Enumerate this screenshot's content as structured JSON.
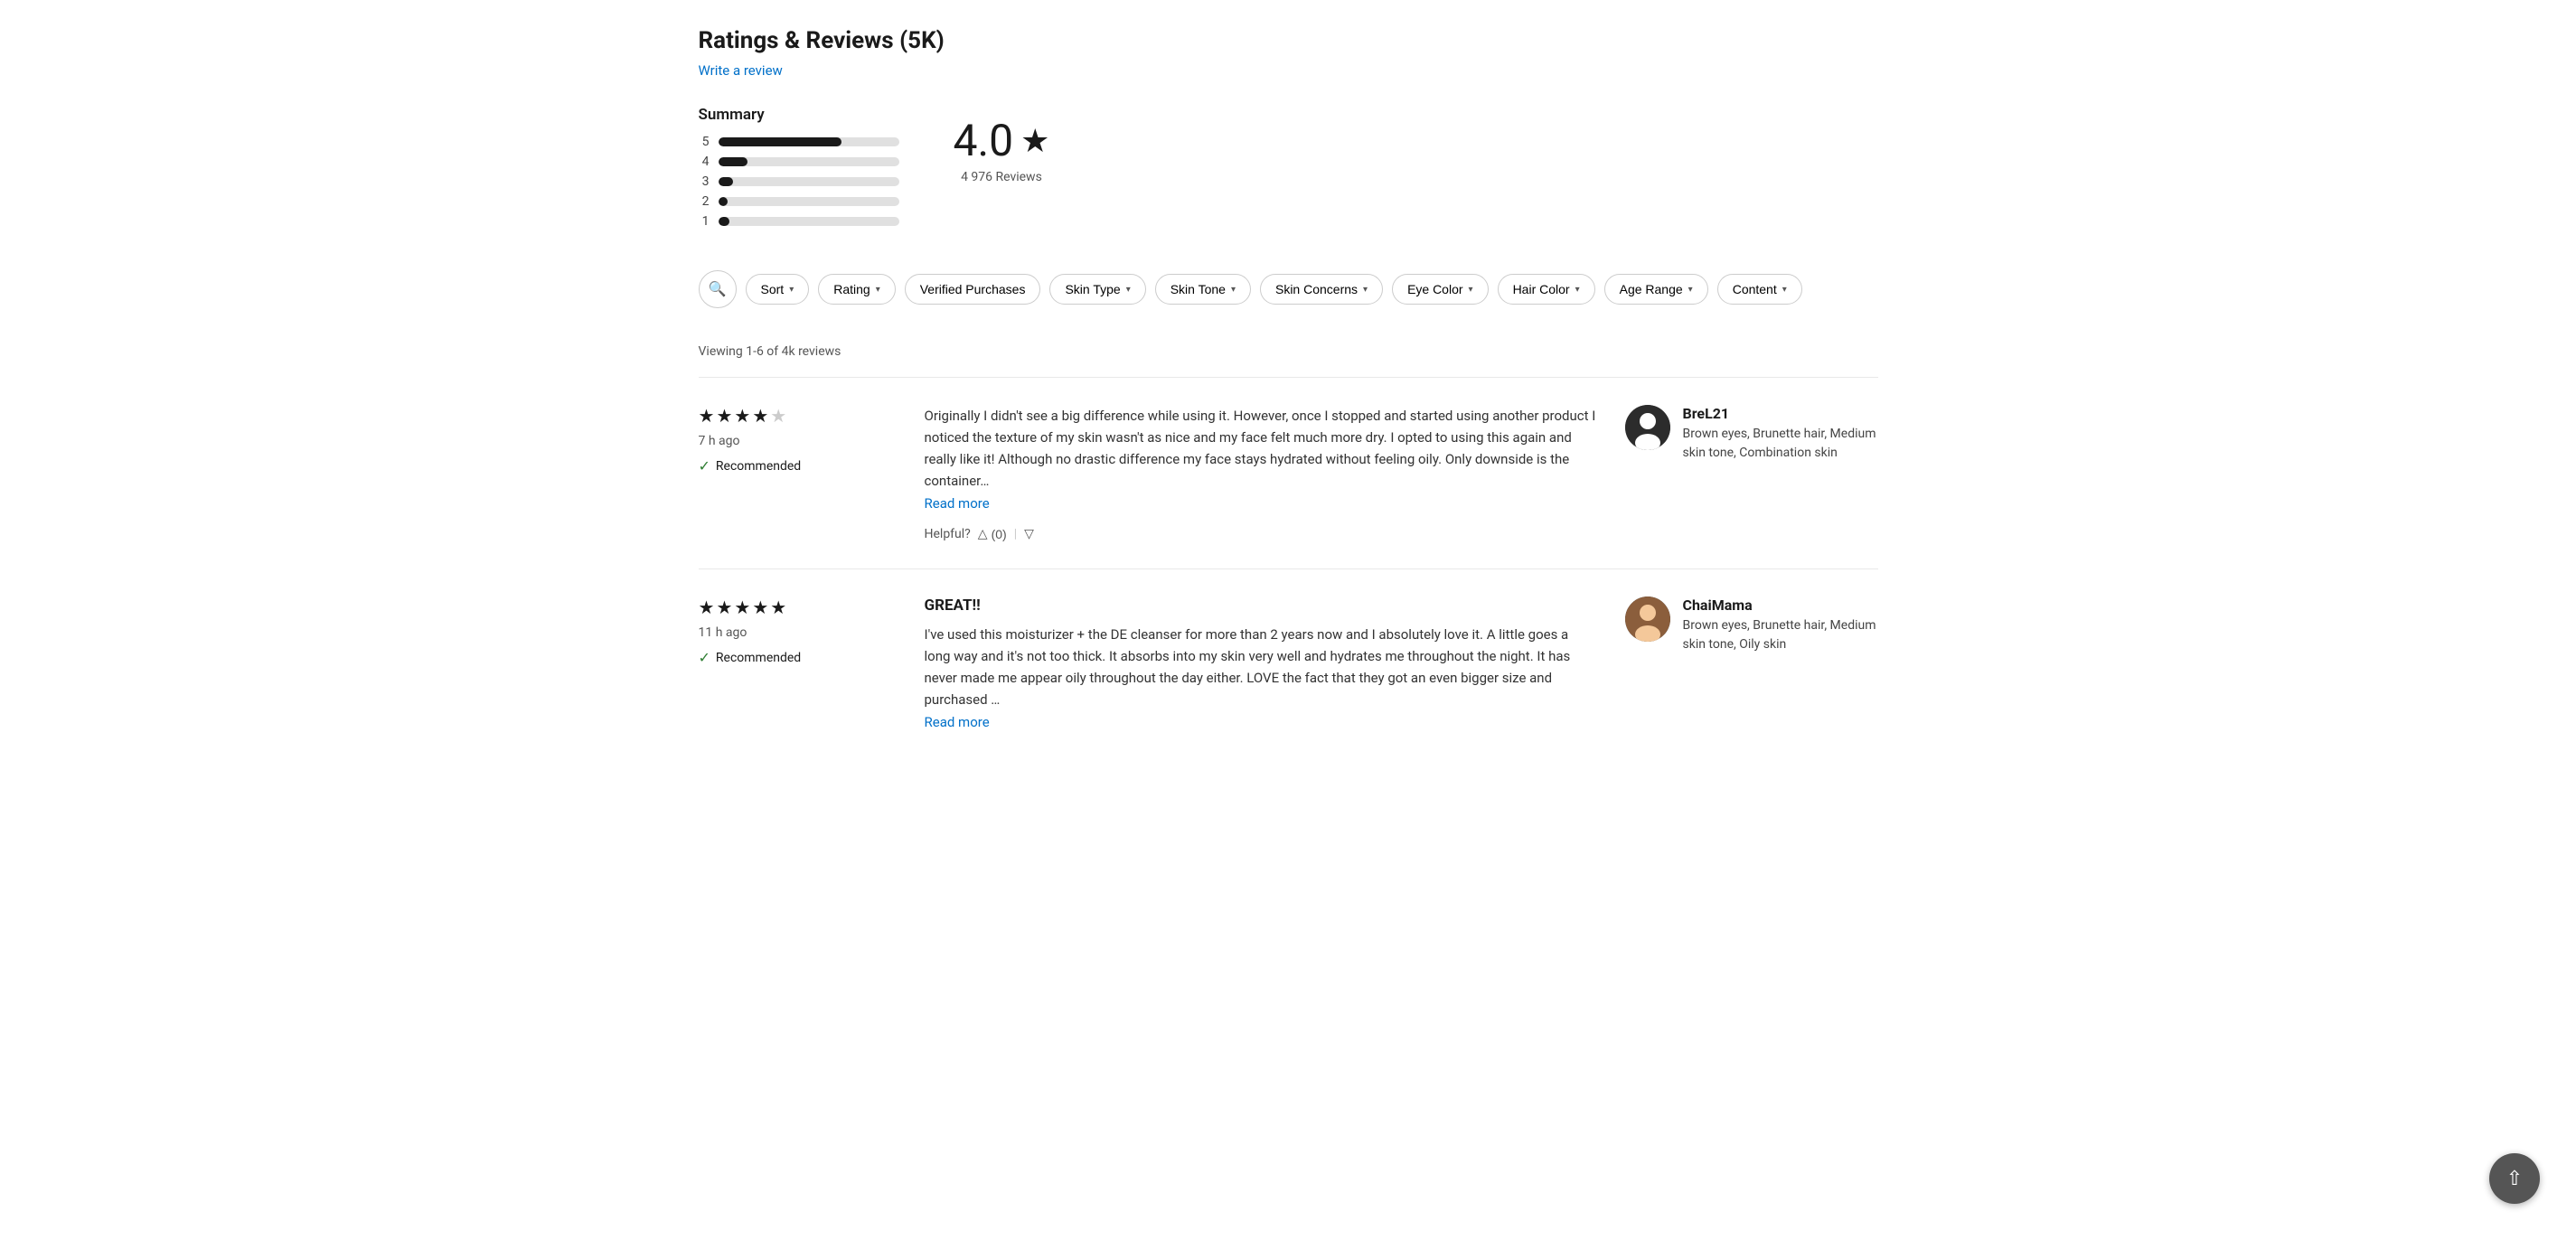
{
  "page": {
    "title": "Ratings & Reviews (5K)",
    "write_review": "Write a review"
  },
  "summary": {
    "label": "Summary",
    "bars": [
      {
        "number": "5",
        "width": "68%"
      },
      {
        "number": "4",
        "width": "16%"
      },
      {
        "number": "3",
        "width": "8%"
      },
      {
        "number": "2",
        "width": "5%"
      },
      {
        "number": "1",
        "width": "6%"
      }
    ],
    "rating": "4.0",
    "star": "★",
    "review_count": "4 976 Reviews"
  },
  "filters": [
    {
      "id": "sort",
      "label": "Sort",
      "has_chevron": true
    },
    {
      "id": "rating",
      "label": "Rating",
      "has_chevron": true
    },
    {
      "id": "verified",
      "label": "Verified Purchases",
      "has_chevron": false
    },
    {
      "id": "skin-type",
      "label": "Skin Type",
      "has_chevron": true
    },
    {
      "id": "skin-tone",
      "label": "Skin Tone",
      "has_chevron": true
    },
    {
      "id": "skin-concerns",
      "label": "Skin Concerns",
      "has_chevron": true
    },
    {
      "id": "eye-color",
      "label": "Eye Color",
      "has_chevron": true
    },
    {
      "id": "hair-color",
      "label": "Hair Color",
      "has_chevron": true
    },
    {
      "id": "age-range",
      "label": "Age Range",
      "has_chevron": true
    },
    {
      "id": "content",
      "label": "Content",
      "has_chevron": true
    }
  ],
  "viewing_text": "Viewing 1-6 of 4k reviews",
  "reviews": [
    {
      "id": "review-1",
      "stars": 4,
      "max_stars": 5,
      "time": "7 h ago",
      "recommended": true,
      "recommended_text": "Recommended",
      "title": "",
      "text": "Originally I didn't see a big difference while using it. However, once I stopped and started using another product I noticed the texture of my skin wasn't as nice and my face felt much more dry. I opted to using this again and really like it! Although no drastic difference my face stays hydrated without feeling oily. Only downside is the container…",
      "read_more": "Read more",
      "helpful_label": "Helpful?",
      "helpful_up": "0",
      "reviewer_name": "BreL21",
      "reviewer_attrs": "Brown eyes, Brunette hair, Medium skin tone, Combination skin",
      "avatar_type": "svg_person_dark"
    },
    {
      "id": "review-2",
      "stars": 5,
      "max_stars": 5,
      "time": "11 h ago",
      "recommended": true,
      "recommended_text": "Recommended",
      "title": "GREAT!!",
      "text": "I've used this moisturizer + the DE cleanser for more than 2 years now and I absolutely love it. A little goes a long way and it's not too thick. It absorbs into my skin very well and hydrates me throughout the night. It has never made me appear oily throughout the day either. LOVE the fact that they got an even bigger size and purchased …",
      "read_more": "Read more",
      "helpful_label": "",
      "helpful_up": "",
      "reviewer_name": "ChaiMama",
      "reviewer_attrs": "Brown eyes, Brunette hair, Medium skin tone, Oily skin",
      "avatar_type": "photo_warm"
    }
  ],
  "scroll_top_label": "↑"
}
